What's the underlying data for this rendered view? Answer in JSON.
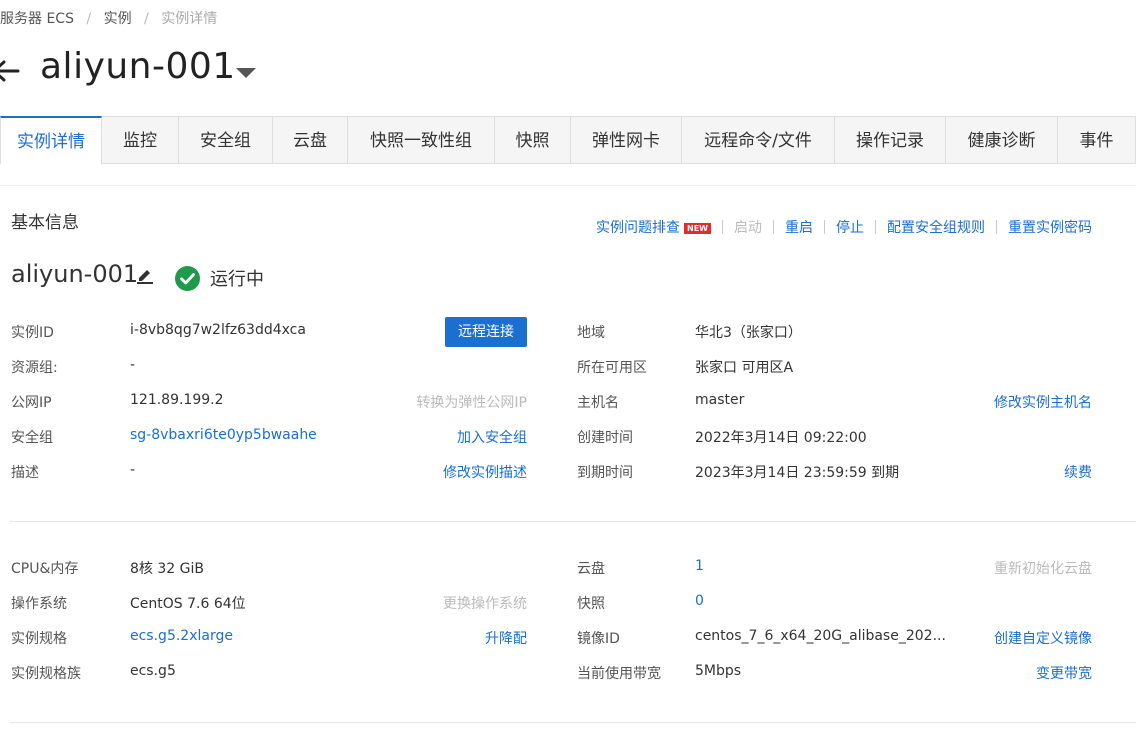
{
  "breadcrumb": {
    "item1": "云服务器 ECS",
    "sep": "/",
    "item2": "实例",
    "item3": "实例详情"
  },
  "title": "aliyun-001",
  "tabs": [
    {
      "label": "实例详情"
    },
    {
      "label": "监控"
    },
    {
      "label": "安全组"
    },
    {
      "label": "云盘"
    },
    {
      "label": "快照一致性组"
    },
    {
      "label": "快照"
    },
    {
      "label": "弹性网卡"
    },
    {
      "label": "远程命令/文件"
    },
    {
      "label": "操作记录"
    },
    {
      "label": "健康诊断"
    },
    {
      "label": "事件"
    }
  ],
  "section": {
    "title": "基本信息"
  },
  "actions": {
    "diagnose": "实例问题排查",
    "new_badge": "NEW",
    "start": "启动",
    "restart": "重启",
    "stop": "停止",
    "sg_rules": "配置安全组规则",
    "reset_pwd": "重置实例密码",
    "more": "⋮"
  },
  "instance": {
    "name": "aliyun-001",
    "status": "运行中"
  },
  "basic_left": {
    "id_label": "实例ID",
    "id_value": "i-8vb8qg7w2lfz63dd4xca",
    "remote_btn": "远程连接",
    "rg_label": "资源组:",
    "rg_value": "-",
    "ip_label": "公网IP",
    "ip_value": "121.89.199.2",
    "ip_action": "转换为弹性公网IP",
    "sg_label": "安全组",
    "sg_value": "sg-8vbaxri6te0yp5bwaahe",
    "sg_action": "加入安全组",
    "desc_label": "描述",
    "desc_value": "-",
    "desc_action": "修改实例描述"
  },
  "basic_right": {
    "region_label": "地域",
    "region_value": "华北3（张家口）",
    "zone_label": "所在可用区",
    "zone_value": "张家口 可用区A",
    "host_label": "主机名",
    "host_value": "master",
    "host_action": "修改实例主机名",
    "created_label": "创建时间",
    "created_value": "2022年3月14日 09:22:00",
    "expire_label": "到期时间",
    "expire_value": "2023年3月14日 23:59:59 到期",
    "expire_action": "续费"
  },
  "config_left": {
    "cpu_label": "CPU&内存",
    "cpu_value": "8核 32 GiB",
    "os_label": "操作系统",
    "os_value": "CentOS 7.6 64位",
    "os_action": "更换操作系统",
    "spec_label": "实例规格",
    "spec_value": "ecs.g5.2xlarge",
    "spec_action": "升降配",
    "family_label": "实例规格族",
    "family_value": "ecs.g5"
  },
  "config_right": {
    "disk_label": "云盘",
    "disk_value": "1",
    "disk_action": "重新初始化云盘",
    "snap_label": "快照",
    "snap_value": "0",
    "image_label": "镜像ID",
    "image_value": "centos_7_6_x64_20G_alibase_202...",
    "image_action": "创建自定义镜像",
    "bw_label": "当前使用带宽",
    "bw_value": "5Mbps",
    "bw_action": "变更带宽"
  },
  "colors": {
    "accent": "#1a6fd1",
    "success": "#1e9a4a",
    "badge": "#e02d2d"
  }
}
